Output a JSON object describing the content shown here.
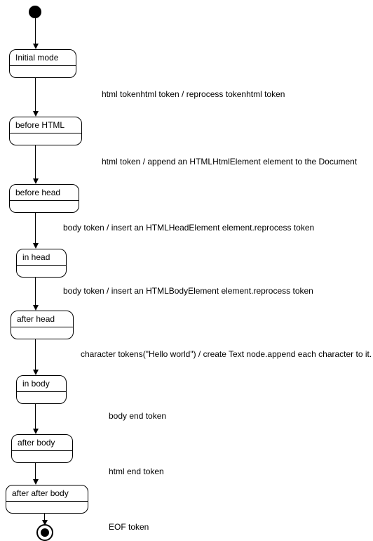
{
  "chart_data": {
    "type": "state_diagram",
    "states": [
      {
        "id": "start",
        "kind": "initial"
      },
      {
        "id": "initial_mode",
        "label": "Initial mode"
      },
      {
        "id": "before_html",
        "label": "before HTML"
      },
      {
        "id": "before_head",
        "label": "before head"
      },
      {
        "id": "in_head",
        "label": "in head"
      },
      {
        "id": "after_head",
        "label": "after head"
      },
      {
        "id": "in_body",
        "label": "in body"
      },
      {
        "id": "after_body",
        "label": "after body"
      },
      {
        "id": "after_after_body",
        "label": "after after body"
      },
      {
        "id": "end",
        "kind": "final"
      }
    ],
    "transitions": [
      {
        "from": "start",
        "to": "initial_mode",
        "label": ""
      },
      {
        "from": "initial_mode",
        "to": "before_html",
        "label": "html tokenhtml token / reprocess tokenhtml token"
      },
      {
        "from": "before_html",
        "to": "before_head",
        "label": "html token / append an HTMLHtmlElement element to the Document"
      },
      {
        "from": "before_head",
        "to": "in_head",
        "label": "body token / insert an HTMLHeadElement element.reprocess token"
      },
      {
        "from": "in_head",
        "to": "after_head",
        "label": "body token / insert an HTMLBodyElement element.reprocess token"
      },
      {
        "from": "after_head",
        "to": "in_body",
        "label": "character tokens(\"Hello world\") / create Text node.append each character to it."
      },
      {
        "from": "in_body",
        "to": "after_body",
        "label": "body end token"
      },
      {
        "from": "after_body",
        "to": "after_after_body",
        "label": "html end token"
      },
      {
        "from": "after_after_body",
        "to": "end",
        "label": "EOF token"
      }
    ]
  }
}
